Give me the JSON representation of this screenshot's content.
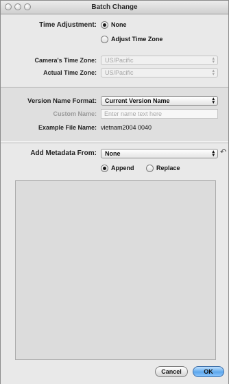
{
  "window": {
    "title": "Batch Change"
  },
  "time_adjustment": {
    "label": "Time Adjustment:",
    "options": [
      {
        "label": "None",
        "selected": true
      },
      {
        "label": "Adjust Time Zone",
        "selected": false
      }
    ]
  },
  "cameras_time_zone": {
    "label": "Camera's Time Zone:",
    "value": "US/Pacific"
  },
  "actual_time_zone": {
    "label": "Actual Time Zone:",
    "value": "US/Pacific"
  },
  "version_name_format": {
    "label": "Version Name Format:",
    "value": "Current Version Name"
  },
  "custom_name": {
    "label": "Custom Name:",
    "placeholder": "Enter name text here"
  },
  "example_file_name": {
    "label": "Example File Name:",
    "value": "vietnam2004 0040"
  },
  "add_metadata_from": {
    "label": "Add Metadata From:",
    "value": "None",
    "mode_options": [
      {
        "label": "Append",
        "selected": true
      },
      {
        "label": "Replace",
        "selected": false
      }
    ]
  },
  "buttons": {
    "cancel": "Cancel",
    "ok": "OK"
  }
}
